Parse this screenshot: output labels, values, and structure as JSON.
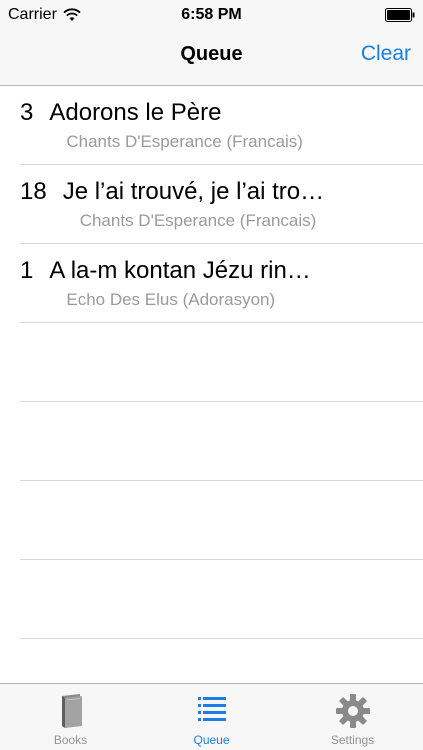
{
  "status_bar": {
    "carrier": "Carrier",
    "time": "6:58 PM",
    "wifi_icon": "wifi-icon",
    "battery_icon": "battery-icon"
  },
  "nav": {
    "title": "Queue",
    "action_label": "Clear",
    "accent_color": "#1a7ee6"
  },
  "queue": {
    "items": [
      {
        "number": "3",
        "title": "Adorons le Père",
        "book": "Chants D'Esperance (Francais)"
      },
      {
        "number": "18",
        "title": "Je l’ai trouvé, je l’ai tro…",
        "book": "Chants D'Esperance (Francais)"
      },
      {
        "number": "1",
        "title": "A la-m kontan Jézu rin…",
        "book": "Echo Des Elus (Adorasyon)"
      }
    ]
  },
  "tab_bar": {
    "tabs": [
      {
        "label": "Books",
        "icon": "book-icon",
        "active": false
      },
      {
        "label": "Queue",
        "icon": "list-icon",
        "active": true
      },
      {
        "label": "Settings",
        "icon": "gear-icon",
        "active": false
      }
    ]
  }
}
